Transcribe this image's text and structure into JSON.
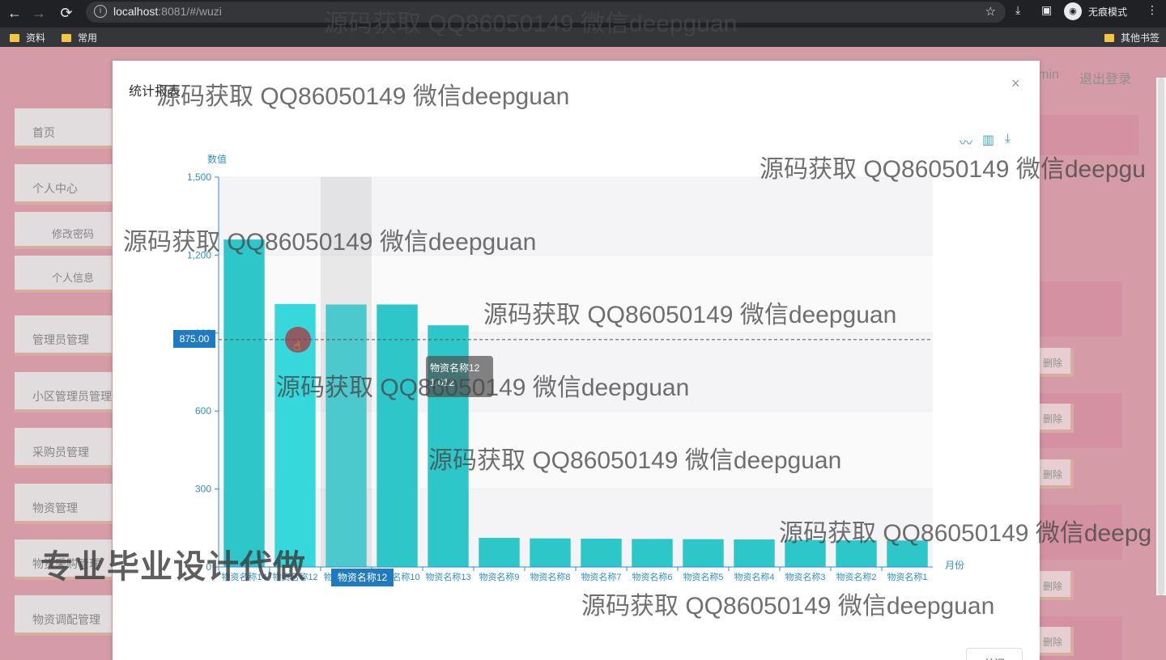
{
  "browser": {
    "url_host": "localhost",
    "url_rest": ":8081/#/wuzi",
    "incognito_label": "无痕模式",
    "bookmarks": [
      "资料",
      "常用"
    ],
    "other_bookmarks": "其他书签"
  },
  "app": {
    "user_partial": "min",
    "logout": "退出登录",
    "sidebar": [
      {
        "label": "首页"
      },
      {
        "label": "个人中心"
      },
      {
        "label": "修改密码"
      },
      {
        "label": "个人信息"
      },
      {
        "label": "管理员管理"
      },
      {
        "label": "小区管理员管理"
      },
      {
        "label": "采购员管理"
      },
      {
        "label": "物资管理"
      },
      {
        "label": "物资采购管理"
      },
      {
        "label": "物资调配管理"
      }
    ],
    "delete_label": "删除"
  },
  "modal": {
    "title": "统计报表",
    "close": "×",
    "footer_button": "关闭"
  },
  "chart_data": {
    "type": "bar",
    "ylabel": "数值",
    "xlabel": "月份",
    "ylim": [
      0,
      1500
    ],
    "yticks": [
      "0",
      "300",
      "600",
      "900",
      "1,200",
      "1,500"
    ],
    "categories": [
      "物资名称14",
      "物资名称12",
      "物资名称11",
      "物资名称10",
      "物资名称13",
      "物资名称9",
      "物资名称8",
      "物资名称7",
      "物资名称6",
      "物资名称5",
      "物资名称4",
      "物资名称3",
      "物资名称2",
      "物资名称1"
    ],
    "values": [
      1260,
      1012,
      1010,
      1010,
      930,
      112,
      110,
      109,
      108,
      107,
      106,
      104,
      103,
      102
    ],
    "bar_color": "#2ec7c9",
    "highlight_index": 2,
    "axis_pointer_value": "875.00",
    "tooltip": {
      "name": "物资名称12",
      "value": "1,012"
    },
    "x_pointer_label": "物资名称12"
  },
  "watermarks": [
    "源码获取 QQ86050149 微信deepguan",
    "源码获取 QQ86050149 微信deepguan",
    "源码获取 QQ86050149 微信deepgu",
    "源码获取 QQ86050149 微信deepguan",
    "源码获取 QQ86050149 微信deepguan",
    "源码获取 QQ86050149 微信deepguan",
    "源码获取 QQ86050149 微信deepguan",
    "源码获取 QQ86050149 微信deepg",
    "源码获取 QQ86050149 微信deepguan"
  ],
  "watermark_bold": "专业毕业设计代做"
}
